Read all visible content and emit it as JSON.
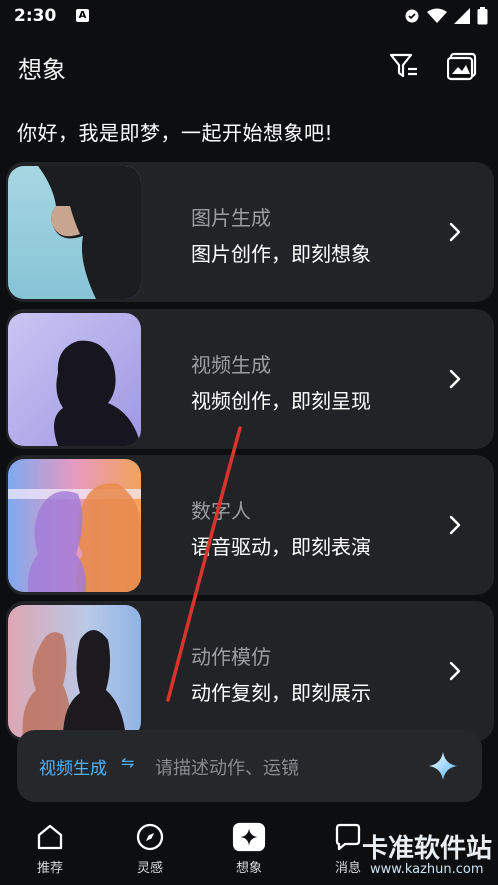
{
  "status_bar": {
    "time": "2:30",
    "notif_icon": "A"
  },
  "top_bar": {
    "title": "想象"
  },
  "greeting": "你好，我是即梦，一起开始想象吧!",
  "cards": [
    {
      "title": "图片生成",
      "subtitle": "图片创作，即刻想象"
    },
    {
      "title": "视频生成",
      "subtitle": "视频创作，即刻呈现"
    },
    {
      "title": "数字人",
      "subtitle": "语音驱动，即刻表演"
    },
    {
      "title": "动作模仿",
      "subtitle": "动作复刻，即刻展示"
    }
  ],
  "prompt": {
    "mode_label": "视频生成",
    "mode_icon": "⇋",
    "placeholder": "请描述动作、运镜"
  },
  "nav": [
    {
      "label": "推荐",
      "icon": "home-icon"
    },
    {
      "label": "灵感",
      "icon": "compass-icon"
    },
    {
      "label": "想象",
      "icon": "sparkle-icon"
    },
    {
      "label": "消息",
      "icon": "message-icon"
    }
  ],
  "watermark": {
    "main": "卡准软件站",
    "url": "www.kazhun.com"
  },
  "colors": {
    "accent": "#4fb3ff",
    "background": "#0d0e10",
    "card": "#222327"
  }
}
